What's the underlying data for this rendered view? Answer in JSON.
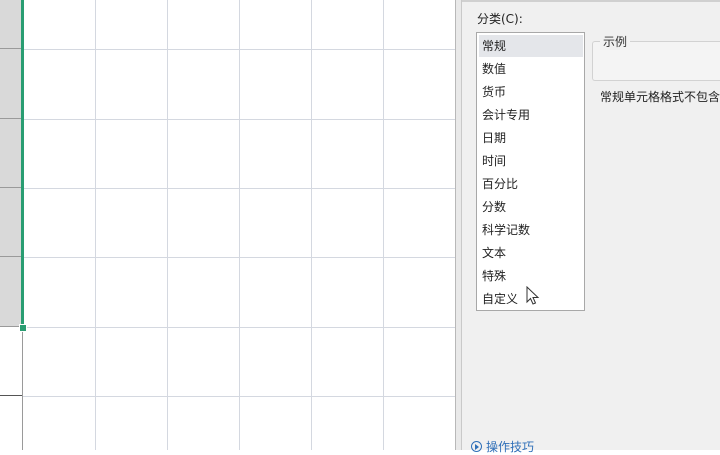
{
  "dialog": {
    "category_label": "分类(C):",
    "categories": [
      "常规",
      "数值",
      "货币",
      "会计专用",
      "日期",
      "时间",
      "百分比",
      "分数",
      "科学记数",
      "文本",
      "特殊",
      "自定义"
    ],
    "selected_category": "常规",
    "sample_label": "示例",
    "description": "常规单元格格式不包含",
    "tips_link": "操作技巧"
  },
  "colors": {
    "selection_accent": "#2a9d72",
    "link": "#2f6fb8"
  },
  "icons": [
    "mouse-pointer-icon",
    "play-circle-icon"
  ]
}
